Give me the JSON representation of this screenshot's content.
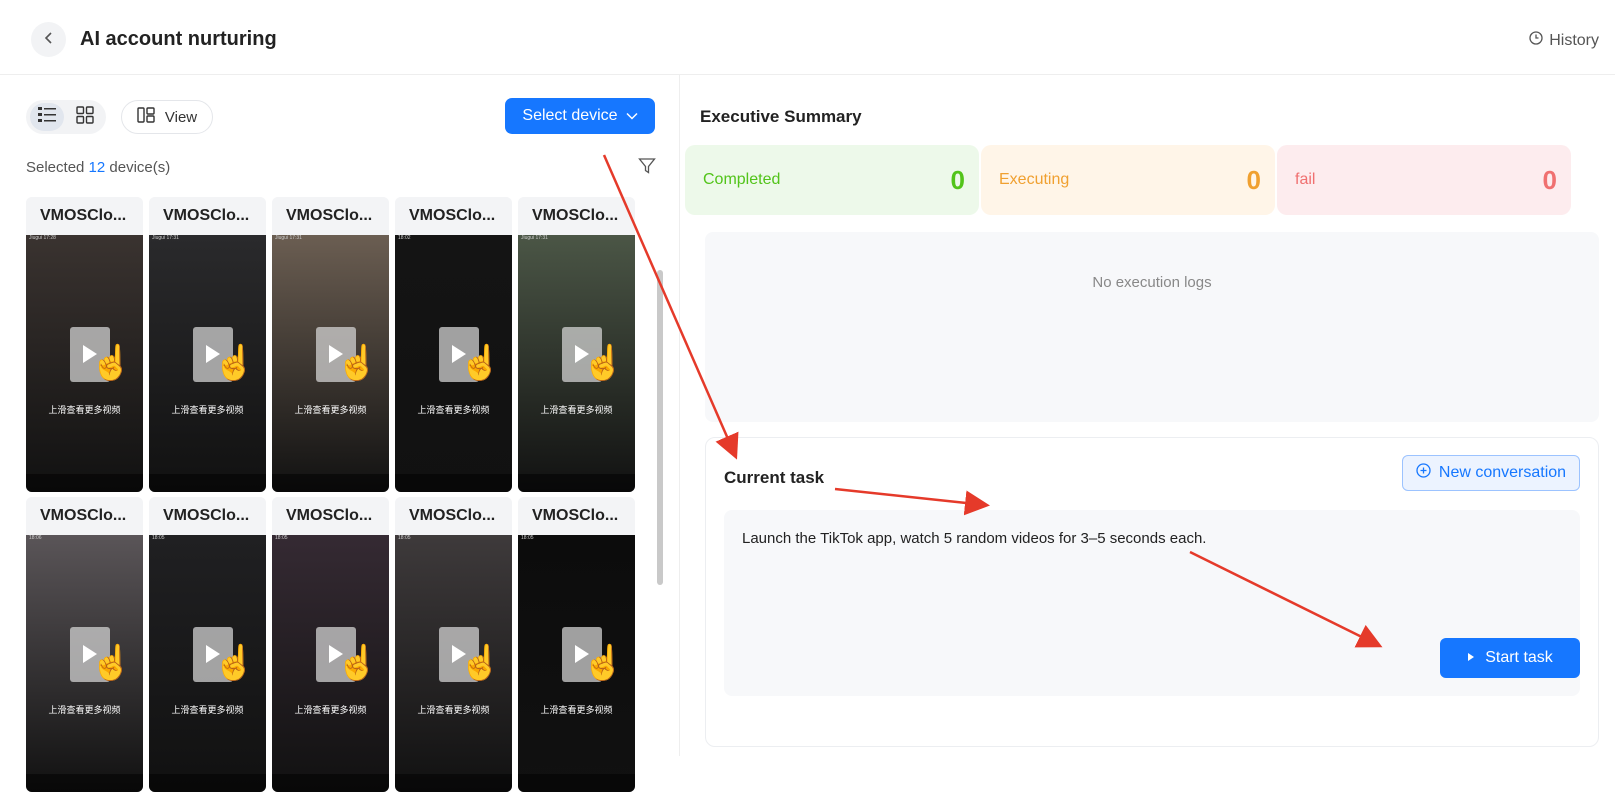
{
  "header": {
    "back_icon": "chevron-left-icon",
    "title": "AI account nurturing",
    "history_label": "History"
  },
  "toolbar": {
    "view_label": "View",
    "select_label": "Select device"
  },
  "selection": {
    "prefix": "Selected",
    "count": "12",
    "suffix": "device(s)"
  },
  "devices": [
    {
      "name": "VMOSClo...",
      "bg": "#3a3330",
      "status": "Jiugui 17:28"
    },
    {
      "name": "VMOSClo...",
      "bg": "#2a2a2c",
      "status": "Jiugui 17:31"
    },
    {
      "name": "VMOSClo...",
      "bg": "#6b5e52",
      "status": "Jiugui 17:31"
    },
    {
      "name": "VMOSClo...",
      "bg": "#141414",
      "status": "18:02"
    },
    {
      "name": "VMOSClo...",
      "bg": "#4b5646",
      "status": "Jiugui 17:31"
    },
    {
      "name": "VMOSClo...",
      "bg": "#5a5558",
      "status": "18:06"
    },
    {
      "name": "VMOSClo...",
      "bg": "#202022",
      "status": "18:05"
    },
    {
      "name": "VMOSClo...",
      "bg": "#352a33",
      "status": "18:05"
    },
    {
      "name": "VMOSClo...",
      "bg": "#3e3a3b",
      "status": "18:05"
    },
    {
      "name": "VMOSClo...",
      "bg": "#0c0c0c",
      "status": "18:05"
    }
  ],
  "device_overlay_text": "上滑查看更多视频",
  "summary": {
    "title": "Executive Summary",
    "completed": {
      "label": "Completed",
      "value": "0",
      "color": "#52c41a",
      "bg": "#edf9ea"
    },
    "executing": {
      "label": "Executing",
      "value": "0",
      "color": "#f0a030",
      "bg": "#fff5e8"
    },
    "fail": {
      "label": "fail",
      "value": "0",
      "color": "#f07070",
      "bg": "#fdecee"
    }
  },
  "logs": {
    "empty_text": "No execution logs"
  },
  "task": {
    "title": "Current task",
    "new_conversation_label": "New conversation",
    "text": "Launch the TikTok app, watch 5 random videos for 3–5 seconds each.",
    "start_label": "Start task"
  },
  "colors": {
    "accent": "#1677ff",
    "annotation": "#e53a2a"
  }
}
